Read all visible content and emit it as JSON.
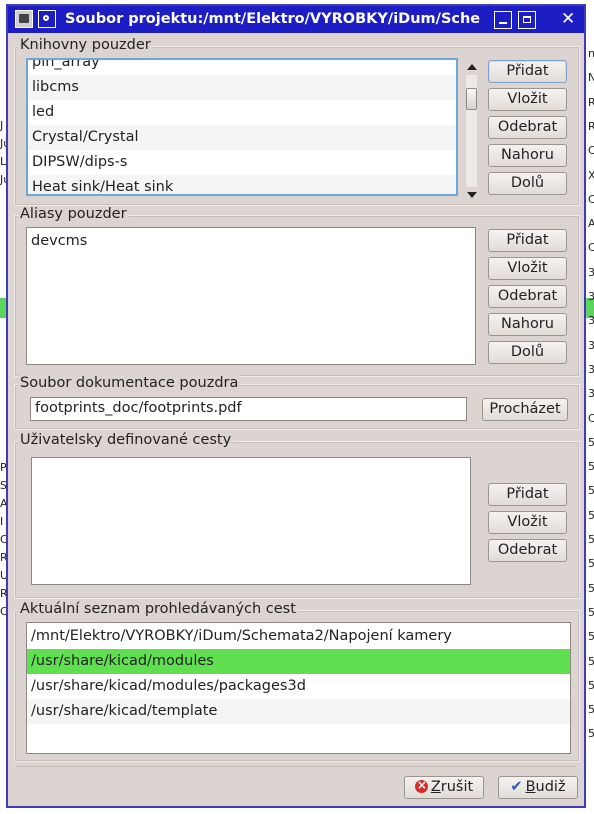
{
  "window": {
    "title": "Soubor projektu:/mnt/Elektro/VYROBKY/iDum/Sche"
  },
  "footprint_libraries": {
    "title": "Knihovny pouzder",
    "items": [
      "pin_array",
      "libcms",
      "led",
      "Crystal/Crystal",
      "DIPSW/dips-s",
      "Heat sink/Heat sink"
    ],
    "buttons": {
      "add": "Přidat",
      "insert": "Vložit",
      "remove": "Odebrat",
      "up": "Nahoru",
      "down": "Dolů"
    }
  },
  "footprint_aliases": {
    "title": "Aliasy pouzder",
    "items": [
      "devcms"
    ],
    "buttons": {
      "add": "Přidat",
      "insert": "Vložit",
      "remove": "Odebrat",
      "up": "Nahoru",
      "down": "Dolů"
    }
  },
  "doc_file": {
    "title": "Soubor dokumentace pouzdra",
    "value": "footprints_doc/footprints.pdf",
    "browse": "Procházet"
  },
  "user_paths": {
    "title": "Uživatelsky definované cesty",
    "items": [],
    "buttons": {
      "add": "Přidat",
      "insert": "Vložit",
      "remove": "Odebrat"
    }
  },
  "search_paths": {
    "title": "Aktuální seznam prohledávaných cest",
    "items": [
      "/mnt/Elektro/VYROBKY/iDum/Schemata2/Napojení kamery",
      "/usr/share/kicad/modules",
      "/usr/share/kicad/modules/packages3d",
      "/usr/share/kicad/template"
    ],
    "selected_index": 1
  },
  "footer": {
    "cancel_prefix": "",
    "cancel_mnemonic": "Z",
    "cancel_rest": "rušit",
    "ok_mnemonic": "B",
    "ok_rest": "udiž"
  },
  "background_chars_right": [
    "n",
    "N",
    "R",
    "R",
    "C",
    "X",
    "C",
    "A",
    "C",
    "3",
    "3",
    "3",
    "3",
    "3",
    "3",
    "C",
    "5",
    "5",
    "5",
    "5",
    "5",
    "5",
    "5",
    "5",
    "5",
    "5",
    "5",
    "5",
    "5"
  ],
  "background_chars_left": [
    "J",
    "Ju",
    "L",
    "Ju",
    "",
    "",
    "",
    "",
    "",
    "",
    "",
    "",
    "",
    "",
    "",
    "",
    "",
    "",
    "",
    "PC",
    "Si",
    "A",
    "I",
    "C",
    "R",
    "U",
    "R",
    "C"
  ],
  "colors": {
    "titlebar": "#1c1ec4",
    "dialog_bg": "#dcd4d0",
    "selection": "#60e050"
  }
}
